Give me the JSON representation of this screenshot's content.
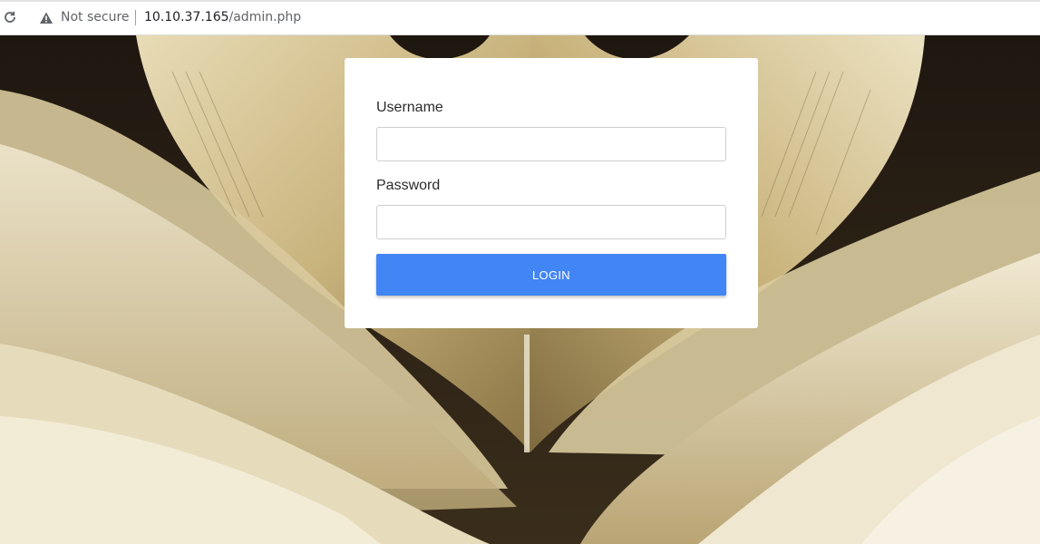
{
  "browser": {
    "security_label": "Not secure",
    "url_host": "10.10.37.165",
    "url_path": "/admin.php",
    "icons": {
      "reload": "reload-icon",
      "warning": "warning-triangle-icon"
    }
  },
  "login": {
    "username_label": "Username",
    "username_value": "",
    "password_label": "Password",
    "password_value": "",
    "button_label": "LOGIN",
    "button_color": "#4285f4"
  },
  "background": {
    "description_icon": "open-book-heart-pages-image"
  }
}
